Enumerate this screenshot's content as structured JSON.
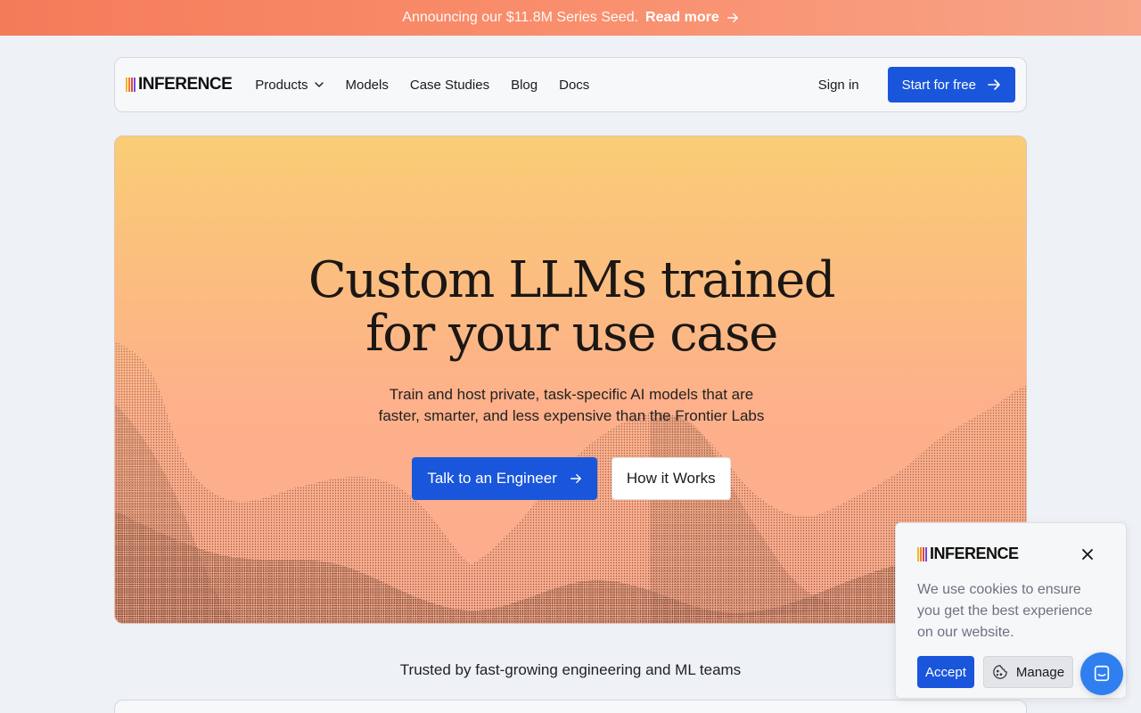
{
  "announcement": {
    "message": "Announcing our $11.8M Series Seed.",
    "link_label": "Read more"
  },
  "brand": {
    "name": "INFERENCE",
    "bar_colors": [
      "#f5b52a",
      "#f07f2a",
      "#e8452f",
      "#6c4cf0"
    ]
  },
  "nav": {
    "items": [
      {
        "label": "Products",
        "has_dropdown": true
      },
      {
        "label": "Models"
      },
      {
        "label": "Case Studies"
      },
      {
        "label": "Blog"
      },
      {
        "label": "Docs"
      }
    ],
    "signin_label": "Sign in",
    "cta_label": "Start for free"
  },
  "hero": {
    "title_line1": "Custom LLMs trained",
    "title_line2": "for your use case",
    "subtitle_line1": "Train and host private, task-specific AI models that are",
    "subtitle_line2": "faster, smarter, and less expensive than the Frontier Labs",
    "primary_cta": "Talk to an Engineer",
    "secondary_cta": "How it Works"
  },
  "trusted": {
    "text": "Trusted by fast-growing engineering and ML teams"
  },
  "cookie": {
    "text": "We use cookies to ensure you get the best experience on our website.",
    "accept_label": "Accept",
    "manage_label": "Manage"
  },
  "colors": {
    "accent": "#1a56db",
    "chat": "#2f7ff0"
  }
}
